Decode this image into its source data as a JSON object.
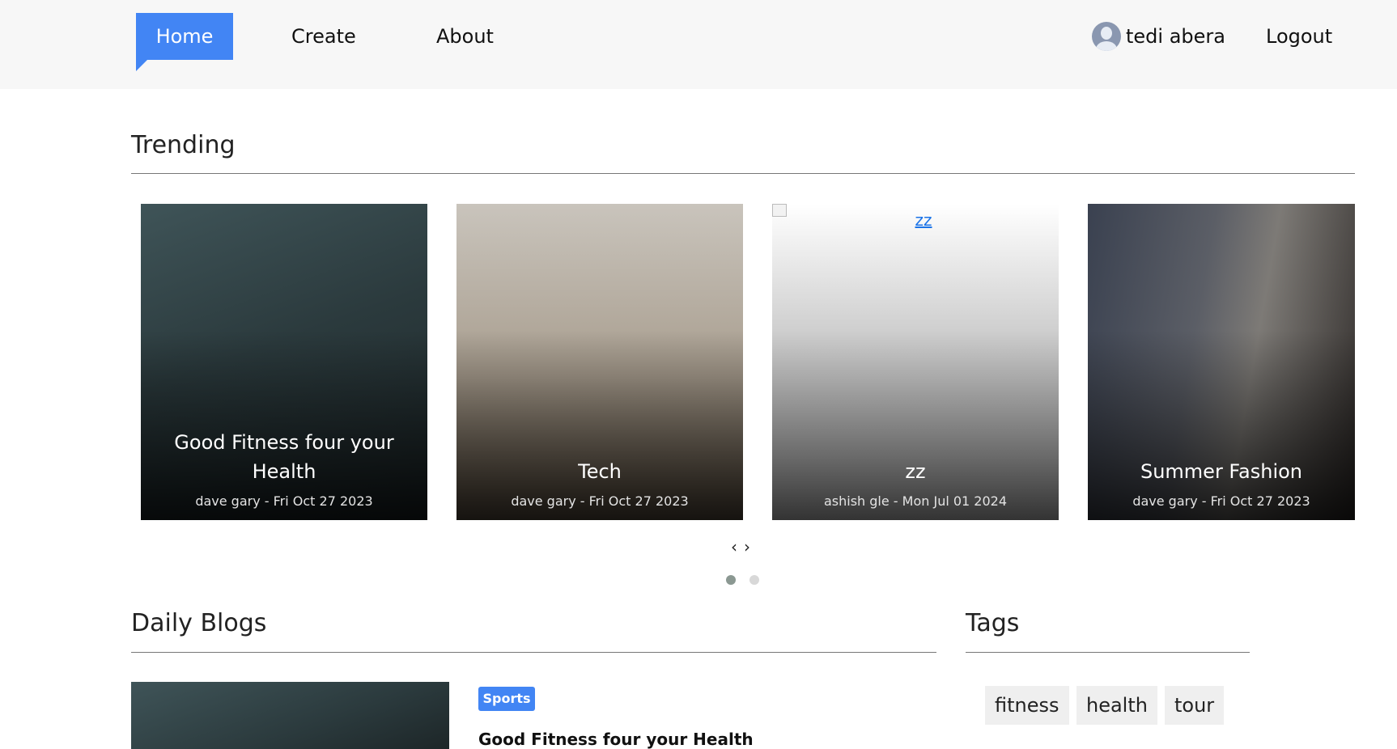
{
  "nav": {
    "home": "Home",
    "create": "Create",
    "about": "About",
    "user_name": "tedi abera",
    "logout": "Logout"
  },
  "trending": {
    "title": "Trending",
    "cards": [
      {
        "title": "Good Fitness four your Health",
        "meta": "dave gary - Fri Oct 27 2023",
        "image": "weightlifting-photo"
      },
      {
        "title": "Tech",
        "meta": "dave gary - Fri Oct 27 2023",
        "image": "child-vr-headset-photo"
      },
      {
        "title": "zz",
        "meta": "ashish gle - Mon Jul 01 2024",
        "image": "broken-image",
        "alt": "zz"
      },
      {
        "title": "Summer Fashion",
        "meta": "dave gary - Fri Oct 27 2023",
        "image": "suit-rack-photo"
      }
    ],
    "prev": "‹",
    "next": "›"
  },
  "daily_blogs": {
    "title": "Daily Blogs",
    "posts": [
      {
        "category": "Sports",
        "title": "Good Fitness four your Health"
      }
    ]
  },
  "tags": {
    "title": "Tags",
    "items": [
      "fitness",
      "health",
      "tour"
    ]
  }
}
